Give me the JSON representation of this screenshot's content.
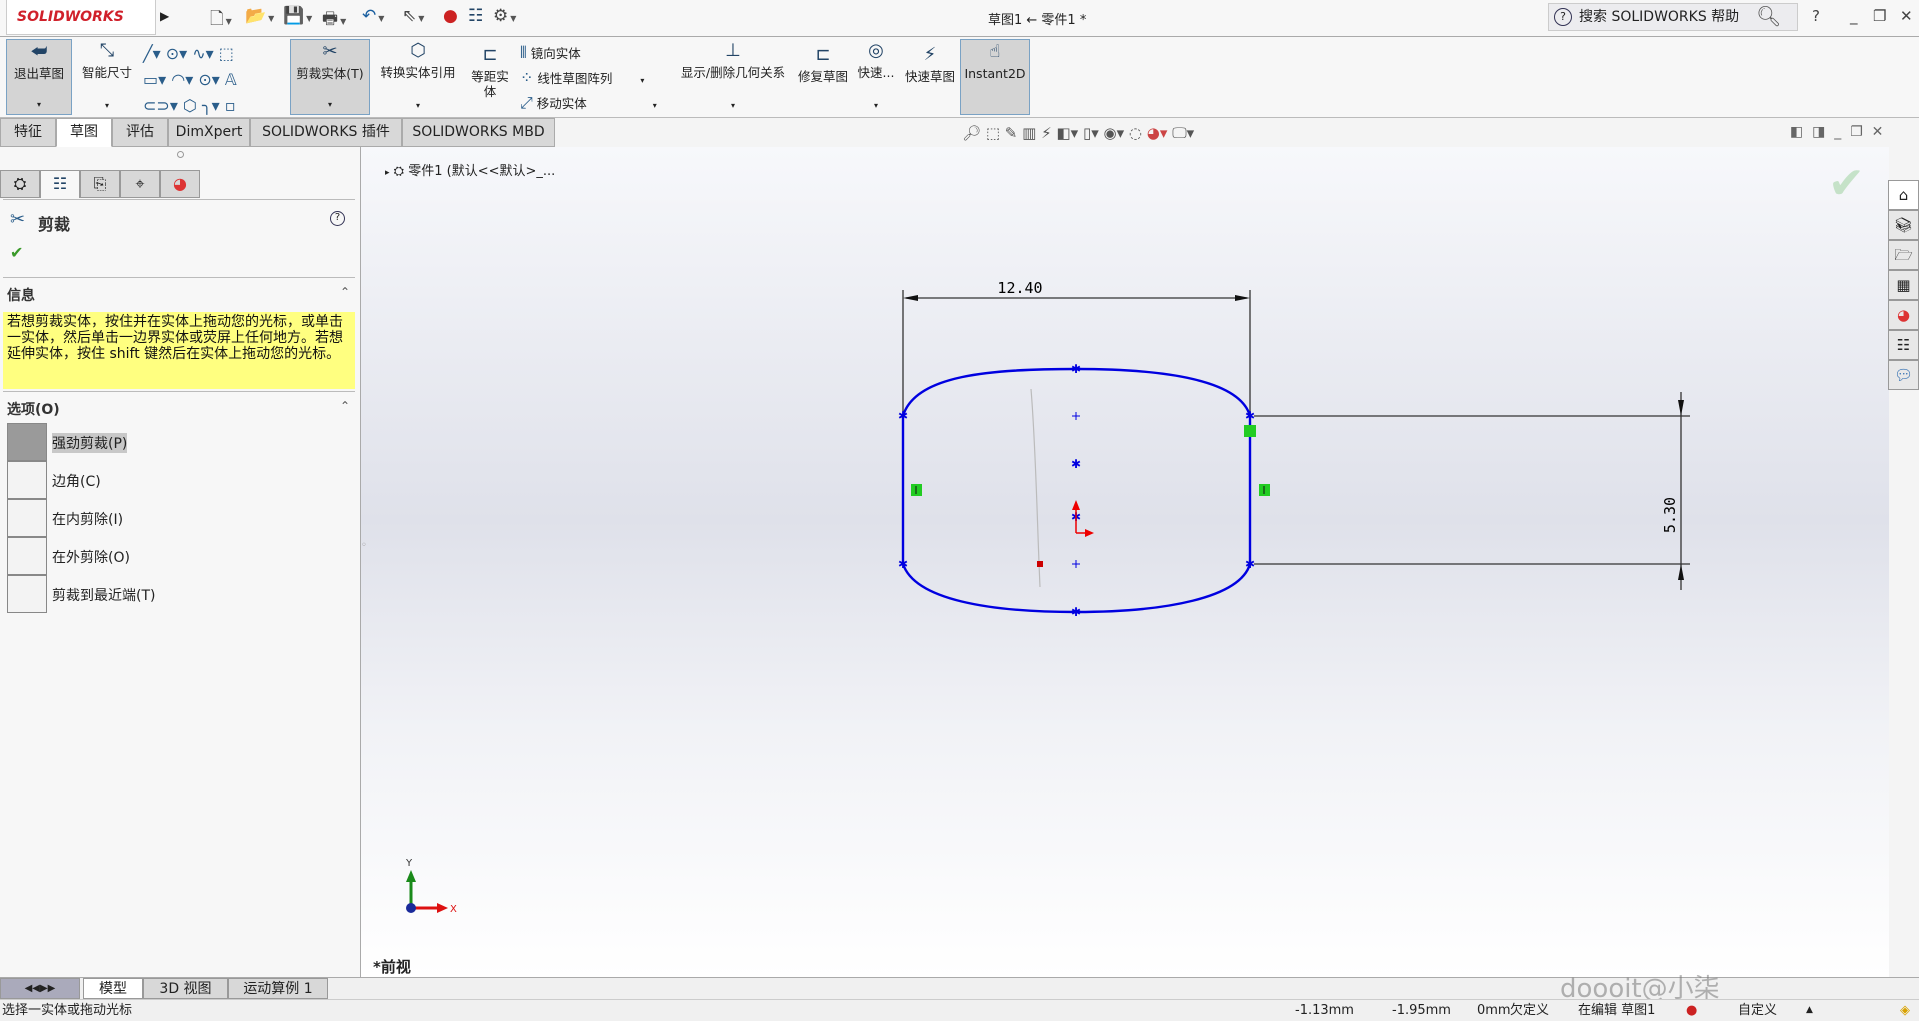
{
  "app": {
    "logo": "SOLIDWORKS",
    "title": "草图1 ← 零件1 *",
    "search_placeholder": "搜索 SOLIDWORKS 帮助",
    "help": "?"
  },
  "quick_access": [
    "new-icon",
    "open-icon",
    "save-icon",
    "print-icon",
    "undo-icon",
    "select-icon",
    "rebuild-icon",
    "file-properties-icon",
    "options-icon"
  ],
  "commands": {
    "exit_sketch": "退出草图",
    "smart_dim": "智能尺寸",
    "trim": "剪裁实体(T)",
    "convert": "转换实体引用",
    "offset": "等距实体",
    "mirror": "镜向实体",
    "linear_pattern": "线性草图阵列",
    "move": "移动实体",
    "relations": "显示/删除几何关系",
    "repair": "修复草图",
    "quick_snaps": "快速...",
    "rapid_sketch": "快速草图",
    "instant2d": "Instant2D"
  },
  "tabs": [
    "特征",
    "草图",
    "评估",
    "DimXpert",
    "SOLIDWORKS 插件",
    "SOLIDWORKS MBD"
  ],
  "active_tab": "草图",
  "panel": {
    "title": "剪裁",
    "info_header": "信息",
    "info_text": "若想剪裁实体，按住并在实体上拖动您的光标，或单击一实体，然后单击一边界实体或荧屏上任何地方。若想延伸实体，按住 shift 键然后在实体上拖动您的光标。",
    "options_header": "选项(O)",
    "options": [
      {
        "label": "强劲剪裁(P)",
        "selected": true
      },
      {
        "label": "边角(C)",
        "selected": false
      },
      {
        "label": "在内剪除(I)",
        "selected": false
      },
      {
        "label": "在外剪除(O)",
        "selected": false
      },
      {
        "label": "剪裁到最近端(T)",
        "selected": false
      }
    ]
  },
  "tree": {
    "part": "零件1 (默认<<默认>_..."
  },
  "sketch": {
    "dim_width": "12.40",
    "dim_height": "5.30",
    "color": "#0000e0"
  },
  "view": {
    "name": "*前视",
    "axis_x": "X",
    "axis_y": "Y"
  },
  "bottom_tabs": [
    "模型",
    "3D 视图",
    "运动算例 1"
  ],
  "status": {
    "message": "选择一实体或拖动光标",
    "x": "-1.13mm",
    "y": "-1.95mm",
    "z": "0mm",
    "state": "欠定义",
    "editing": "在编辑 草图1",
    "units": "自定义"
  },
  "watermark": "doooit@小柒"
}
